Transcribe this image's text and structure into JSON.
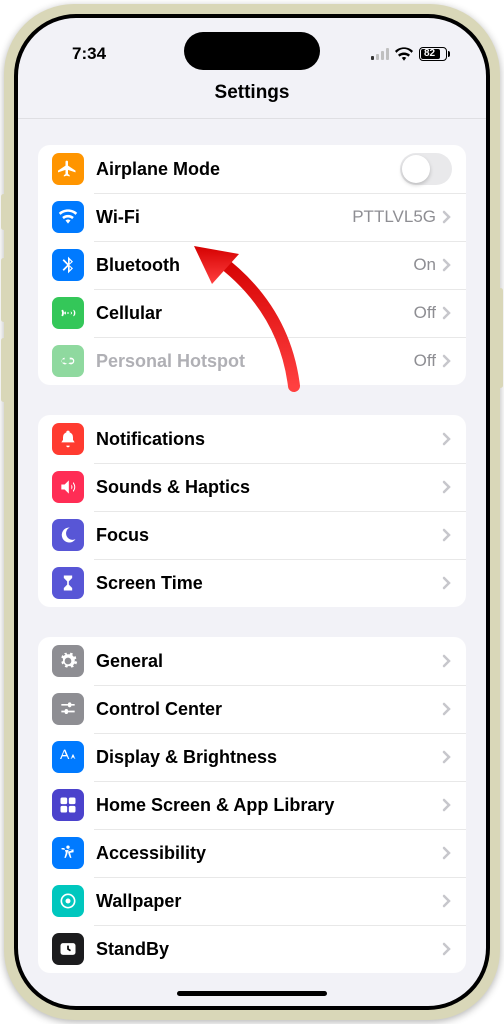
{
  "status": {
    "time": "7:34",
    "battery": "82"
  },
  "title": "Settings",
  "s1": {
    "airplane": {
      "label": "Airplane Mode"
    },
    "wifi": {
      "label": "Wi-Fi",
      "value": "PTTLVL5G"
    },
    "bluetooth": {
      "label": "Bluetooth",
      "value": "On"
    },
    "cellular": {
      "label": "Cellular",
      "value": "Off"
    },
    "hotspot": {
      "label": "Personal Hotspot",
      "value": "Off"
    }
  },
  "s2": {
    "notifications": {
      "label": "Notifications"
    },
    "sounds": {
      "label": "Sounds & Haptics"
    },
    "focus": {
      "label": "Focus"
    },
    "screentime": {
      "label": "Screen Time"
    }
  },
  "s3": {
    "general": {
      "label": "General"
    },
    "controlcenter": {
      "label": "Control Center"
    },
    "display": {
      "label": "Display & Brightness"
    },
    "homescreen": {
      "label": "Home Screen & App Library"
    },
    "accessibility": {
      "label": "Accessibility"
    },
    "wallpaper": {
      "label": "Wallpaper"
    },
    "standby": {
      "label": "StandBy"
    }
  },
  "colors": {
    "orange": "#ff9500",
    "blue": "#007aff",
    "green": "#34c759",
    "lgreen": "#8fd99f",
    "red": "#ff3b30",
    "pink": "#ff2d55",
    "indigo": "#5856d6",
    "purple": "#5e5ce6",
    "gray": "#8e8e93",
    "lgray": "#a5a6ac",
    "teal": "#00c7be",
    "black": "#1c1c1e"
  }
}
